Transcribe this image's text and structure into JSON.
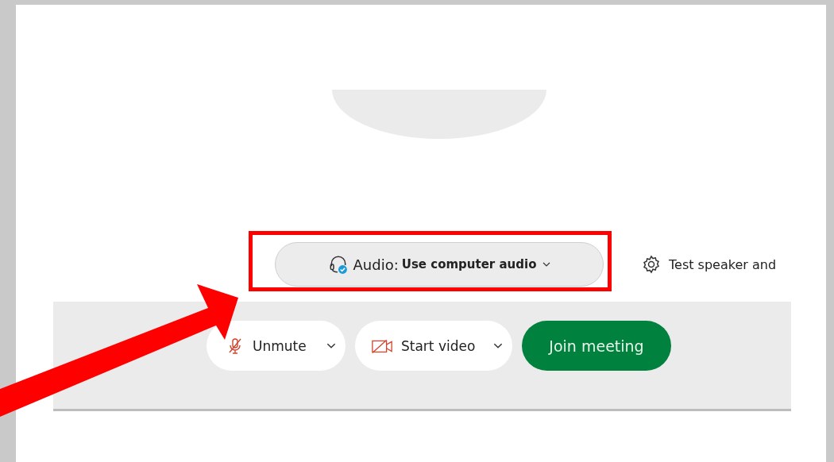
{
  "audio": {
    "label": "Audio:",
    "value": "Use computer audio"
  },
  "test_link": {
    "label": "Test speaker and"
  },
  "controls": [
    {
      "kind": "mic",
      "label": "Unmute"
    },
    {
      "kind": "video",
      "label": "Start video"
    },
    {
      "kind": "primary",
      "label": "Join meeting"
    }
  ]
}
